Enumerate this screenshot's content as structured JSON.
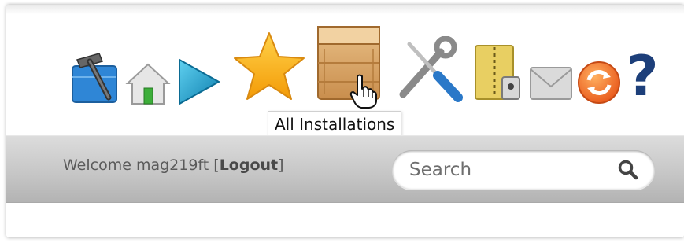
{
  "toolbar": {
    "icons": [
      "tools-icon",
      "home-icon",
      "play-icon",
      "star-icon",
      "box-icon",
      "wrench-screwdriver-icon",
      "archive-icon",
      "mail-icon",
      "refresh-icon",
      "help-icon"
    ],
    "help_label": "?"
  },
  "tooltip": {
    "text": "All Installations"
  },
  "userbar": {
    "welcome_prefix": "Welcome mag219ft [",
    "logout_label": "Logout",
    "welcome_suffix": "]"
  },
  "search": {
    "placeholder": "Search"
  }
}
